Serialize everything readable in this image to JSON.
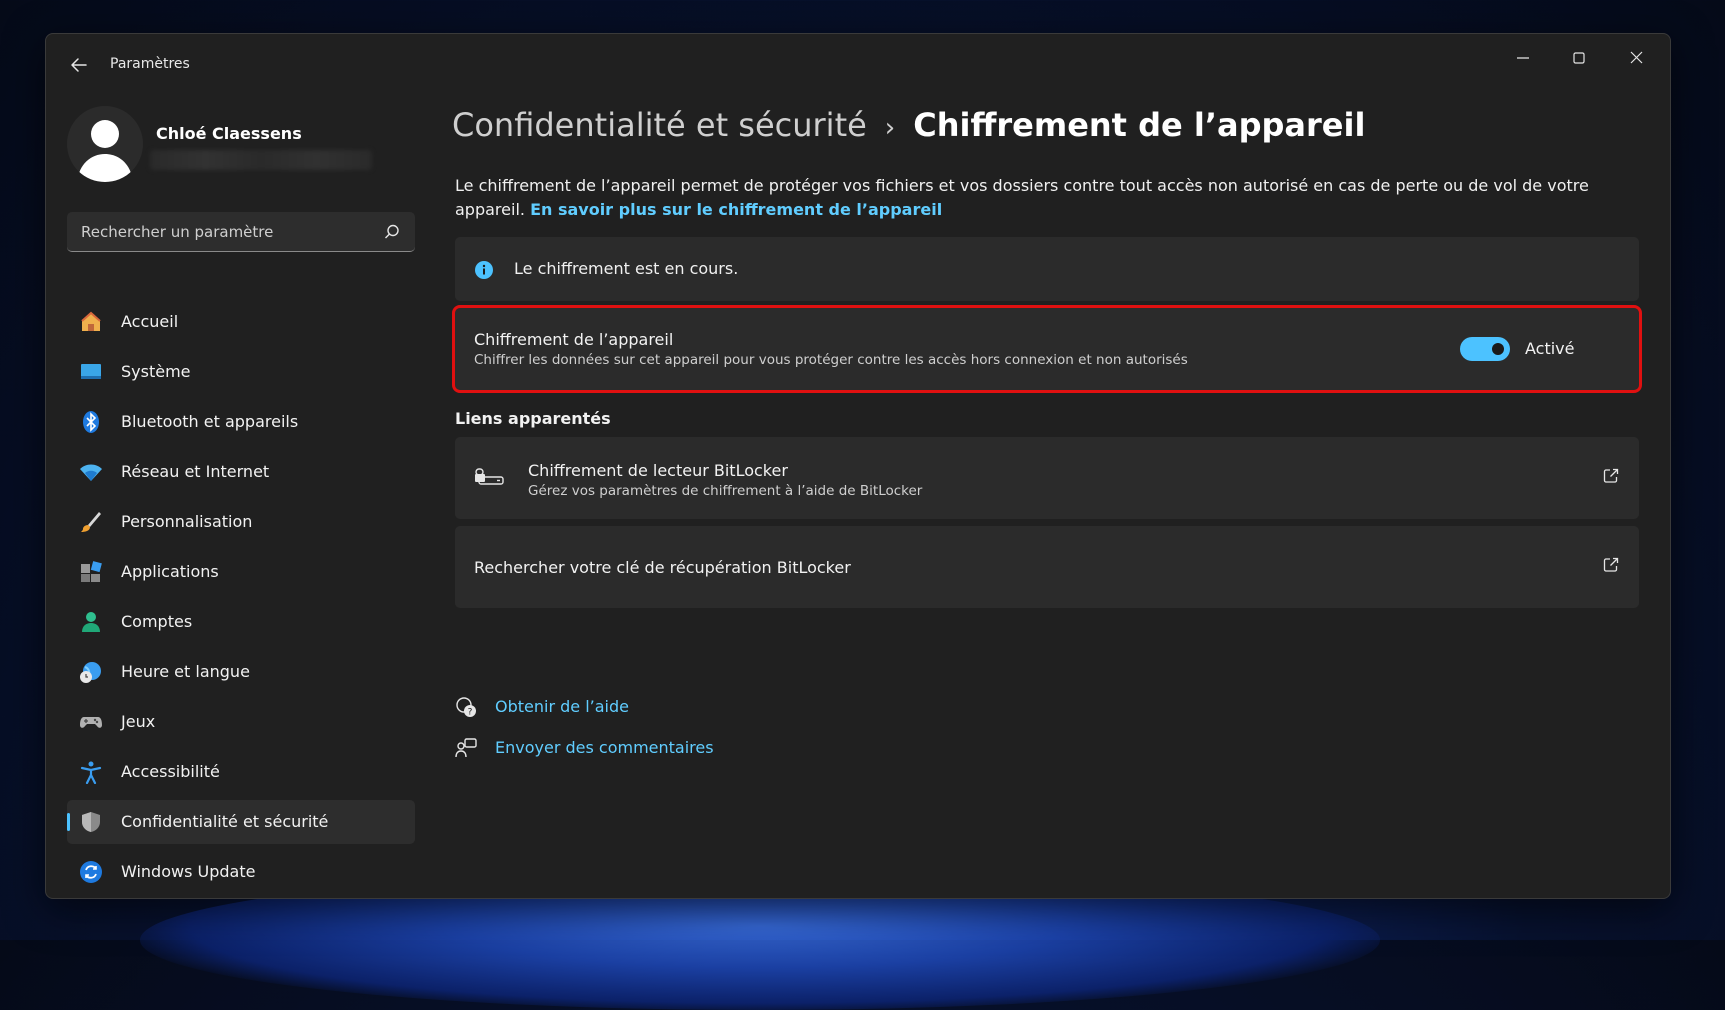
{
  "window": {
    "title": "Paramètres"
  },
  "user": {
    "name": "Chloé Claessens"
  },
  "search": {
    "placeholder": "Rechercher un paramètre"
  },
  "sidebar": {
    "items": [
      {
        "label": "Accueil",
        "icon": "home-icon"
      },
      {
        "label": "Système",
        "icon": "monitor-icon"
      },
      {
        "label": "Bluetooth et appareils",
        "icon": "bluetooth-icon"
      },
      {
        "label": "Réseau et Internet",
        "icon": "wifi-icon"
      },
      {
        "label": "Personnalisation",
        "icon": "brush-icon"
      },
      {
        "label": "Applications",
        "icon": "apps-icon"
      },
      {
        "label": "Comptes",
        "icon": "account-icon"
      },
      {
        "label": "Heure et langue",
        "icon": "globe-clock-icon"
      },
      {
        "label": "Jeux",
        "icon": "gamepad-icon"
      },
      {
        "label": "Accessibilité",
        "icon": "accessibility-icon"
      },
      {
        "label": "Confidentialité et sécurité",
        "icon": "shield-icon",
        "active": true
      },
      {
        "label": "Windows Update",
        "icon": "update-icon"
      }
    ]
  },
  "breadcrumb": {
    "parent": "Confidentialité et sécurité",
    "separator": "›",
    "current": "Chiffrement de l’appareil"
  },
  "main": {
    "description": "Le chiffrement de l’appareil permet de protéger vos fichiers et vos dossiers contre tout accès non autorisé en cas de perte ou de vol de votre appareil. ",
    "description_link": "En savoir plus sur le chiffrement de l’appareil",
    "info_message": "Le chiffrement est en cours.",
    "encryption_card": {
      "title": "Chiffrement de l’appareil",
      "subtitle": "Chiffrer les données sur cet appareil pour vous protéger contre les accès hors connexion et non autorisés",
      "toggle_state": "Activé",
      "toggle_on": true
    },
    "related_heading": "Liens apparentés",
    "links": [
      {
        "title": "Chiffrement de lecteur BitLocker",
        "subtitle": "Gérez vos paramètres de chiffrement à l’aide de BitLocker"
      },
      {
        "title": "Rechercher votre clé de récupération BitLocker"
      }
    ],
    "help": {
      "get_help": "Obtenir de l’aide",
      "feedback": "Envoyer des commentaires"
    }
  },
  "colors": {
    "accent": "#4cc2ff",
    "link": "#60cdff",
    "highlight_border": "#e01010",
    "window_bg": "#202020",
    "card_bg": "#2b2b2b"
  }
}
